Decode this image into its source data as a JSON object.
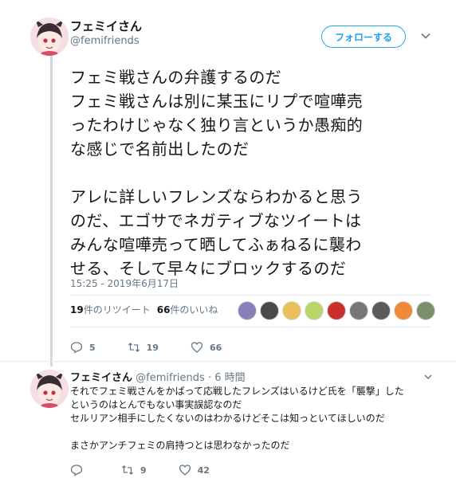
{
  "tweet": {
    "author_name": "フェミイさん",
    "author_handle": "@femifriends",
    "follow_label": "フォローする",
    "text_lines": [
      "フェミ戦さんの弁護するのだ",
      "フェミ戦さんは別に某玉にリプで喧嘩売",
      "ったわけじゃなく独り言というか愚痴的",
      "な感じで名前出したのだ",
      "",
      "アレに詳しいフレンズならわかると思う",
      "のだ、エゴサでネガティブなツイートは",
      "みんな喧嘩売って晒してふぁねるに襲わ",
      "せる、そして早々にブロックするのだ"
    ],
    "timestamp": "15:25 - 2019年6月17日",
    "retweets_count": "19",
    "retweets_label": "件のリツイート",
    "likes_count": "66",
    "likes_label": "件のいいね",
    "liker_avatar_colors": [
      "#8a7fb8",
      "#4a4a4a",
      "#e8c15a",
      "#b8d66a",
      "#c9302c",
      "#777777",
      "#5a5a5a",
      "#f0883a",
      "#7a8f6a"
    ],
    "actions": {
      "reply_count": "5",
      "retweet_count": "19",
      "like_count": "66"
    }
  },
  "reply": {
    "author_name": "フェミイさん",
    "author_handle": "@femifriends",
    "time": "· 6 時間",
    "text_lines": [
      "それでフェミ戦さんをかばって応戦したフレンズはいるけど氏を「襲撃」した",
      "というのはとんでもない事実誤認なのだ",
      "セルリアン相手にしたくないのはわかるけどそこは知っといてほしいのだ",
      "",
      "まさかアンチフェミの肩持つとは思わなかったのだ"
    ],
    "actions": {
      "reply_count": "",
      "retweet_count": "9",
      "like_count": "42"
    }
  },
  "colors": {
    "accent": "#1da1f2",
    "muted": "#657786",
    "thread_line": "#cfd9e2"
  },
  "icons": {
    "reply": "reply-icon",
    "retweet": "retweet-icon",
    "like": "heart-icon",
    "menu": "chevron-down-icon"
  }
}
